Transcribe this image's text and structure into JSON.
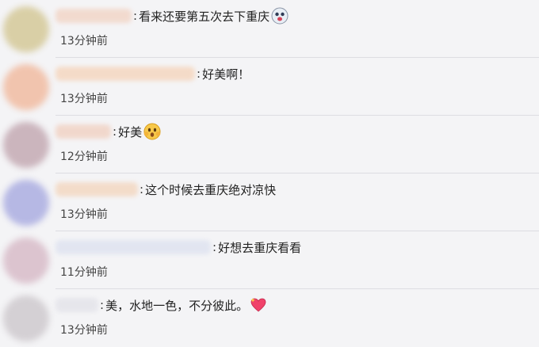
{
  "comments": [
    {
      "text": "看来还要第五次去下重庆",
      "time": "13分钟前",
      "emoji": "ghost-face-icon",
      "avatar_color": "#d9cfa6",
      "name_color": "#f2d6c8"
    },
    {
      "text": "好美啊！",
      "time": "13分钟前",
      "emoji": "",
      "avatar_color": "#f1c4ae",
      "name_color": "#f5d7c0"
    },
    {
      "text": "好美",
      "time": "12分钟前",
      "emoji": "shocked-face-icon",
      "avatar_color": "#cbb5bd",
      "name_color": "#f1d3c5"
    },
    {
      "text": "这个时候去重庆绝对凉快",
      "time": "13分钟前",
      "emoji": "",
      "avatar_color": "#b6b8e4",
      "name_color": "#f3d8c2"
    },
    {
      "text": "好想去重庆看看",
      "time": "11分钟前",
      "emoji": "",
      "avatar_color": "#dcc4cf",
      "name_color": "#dfe3f0"
    },
    {
      "text": "美，水地一色，不分彼此。",
      "time": "13分钟前",
      "emoji": "sparkling-heart-icon",
      "avatar_color": "#d4d0d4",
      "name_color": "#e4e4ea"
    }
  ]
}
